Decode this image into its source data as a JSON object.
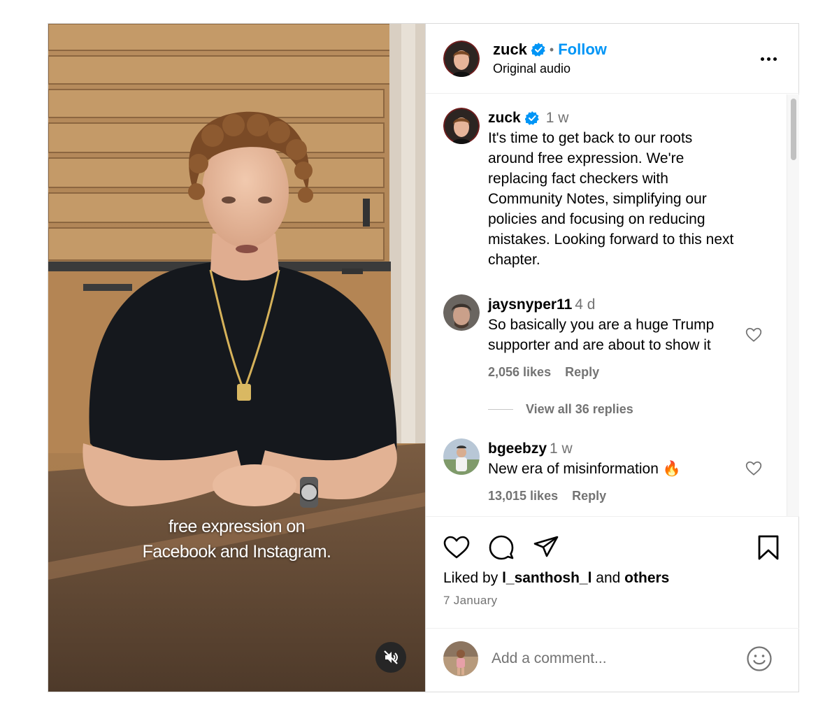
{
  "video": {
    "caption_line1": "free expression on",
    "caption_line2": "Facebook and Instagram.",
    "mute_icon": "speaker-muted-icon"
  },
  "header": {
    "username": "zuck",
    "separator": "•",
    "follow_label": "Follow",
    "subtitle": "Original audio",
    "more_icon": "more-options-icon"
  },
  "caption_post": {
    "username": "zuck",
    "time": "1 w",
    "text_lines": [
      "It's time to get back to our roots",
      "around free expression. We're",
      "replacing fact checkers with",
      "Community Notes, simplifying our",
      "policies and focusing on reducing",
      "mistakes. Looking forward to this next",
      "chapter."
    ]
  },
  "comments": [
    {
      "username": "jaysnyper11",
      "time": "4 d",
      "text_lines": [
        "So basically you are a huge Trump",
        "supporter and are about to show it"
      ],
      "likes": "2,056 likes",
      "reply_label": "Reply",
      "view_replies": "View all 36 replies"
    },
    {
      "username": "bgeebzy",
      "time": "1 w",
      "text": "New era of misinformation",
      "emoji": "🔥",
      "likes": "13,015 likes",
      "reply_label": "Reply"
    }
  ],
  "actions": {
    "liked_by_prefix": "Liked by",
    "liked_by_user": "l_santhosh_l",
    "liked_by_and": "and",
    "liked_by_others": "others",
    "date": "7 January"
  },
  "add_comment": {
    "placeholder": "Add a comment..."
  },
  "colors": {
    "link_blue": "#0095f6",
    "verified_blue": "#0095f6",
    "muted_text": "#737373",
    "border": "#dbdbdb"
  }
}
